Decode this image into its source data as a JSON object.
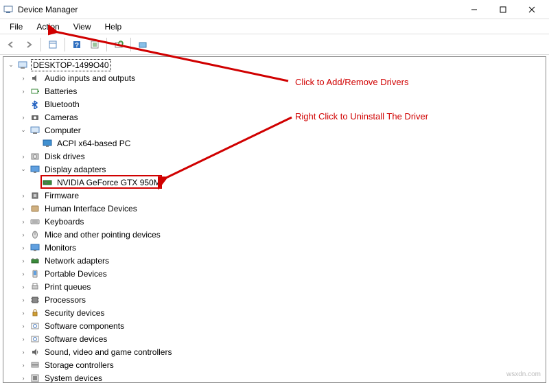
{
  "window": {
    "title": "Device Manager"
  },
  "menubar": {
    "file": "File",
    "action": "Action",
    "view": "View",
    "help": "Help"
  },
  "tree": {
    "root": "DESKTOP-1499O40",
    "items": [
      {
        "label": "Audio inputs and outputs",
        "expander": ">"
      },
      {
        "label": "Batteries",
        "expander": ">"
      },
      {
        "label": "Bluetooth",
        "expander": ""
      },
      {
        "label": "Cameras",
        "expander": ">"
      },
      {
        "label": "Computer",
        "expander": "v"
      },
      {
        "label": "ACPI x64-based PC",
        "expander": "",
        "indent": 2
      },
      {
        "label": "Disk drives",
        "expander": ">"
      },
      {
        "label": "Display adapters",
        "expander": "v"
      },
      {
        "label": "NVIDIA GeForce GTX 950M",
        "expander": "",
        "indent": 2,
        "highlighted": true
      },
      {
        "label": "Firmware",
        "expander": ">"
      },
      {
        "label": "Human Interface Devices",
        "expander": ">"
      },
      {
        "label": "Keyboards",
        "expander": ">"
      },
      {
        "label": "Mice and other pointing devices",
        "expander": ">"
      },
      {
        "label": "Monitors",
        "expander": ">"
      },
      {
        "label": "Network adapters",
        "expander": ">"
      },
      {
        "label": "Portable Devices",
        "expander": ">"
      },
      {
        "label": "Print queues",
        "expander": ">"
      },
      {
        "label": "Processors",
        "expander": ">"
      },
      {
        "label": "Security devices",
        "expander": ">"
      },
      {
        "label": "Software components",
        "expander": ">"
      },
      {
        "label": "Software devices",
        "expander": ">"
      },
      {
        "label": "Sound, video and game controllers",
        "expander": ">"
      },
      {
        "label": "Storage controllers",
        "expander": ">"
      },
      {
        "label": "System devices",
        "expander": ">"
      }
    ]
  },
  "annotations": {
    "top": "Click to Add/Remove Drivers",
    "bottom": "Right Click to Uninstall The Driver"
  },
  "watermark": "wsxdn.com"
}
